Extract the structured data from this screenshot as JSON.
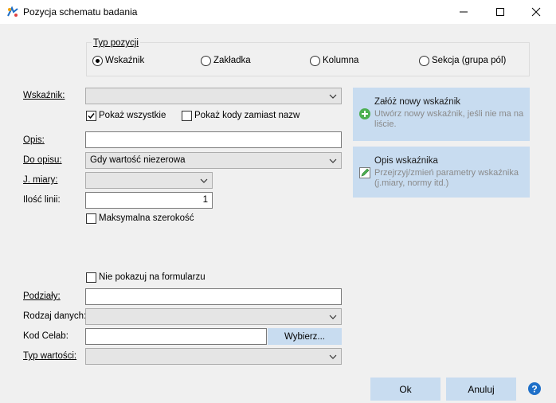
{
  "window": {
    "title": "Pozycja schematu badania",
    "icons": [
      "app-icon",
      "minimize-icon",
      "maximize-icon",
      "close-icon"
    ]
  },
  "type_group": {
    "title": "Typ pozycji",
    "options": [
      {
        "label": "Wskaźnik",
        "selected": true
      },
      {
        "label": "Zakładka",
        "selected": false
      },
      {
        "label": "Kolumna",
        "selected": false
      },
      {
        "label": "Sekcja (grupa pól)",
        "selected": false
      }
    ]
  },
  "form": {
    "wskaznik_label": "Wskaźnik:",
    "wskaznik_value": "",
    "show_all_label": "Pokaż wszystkie",
    "show_all_checked": true,
    "show_codes_label": "Pokaż kody zamiast nazw",
    "show_codes_checked": false,
    "opis_label": "Opis:",
    "opis_value": "",
    "do_opisu_label": "Do opisu:",
    "do_opisu_value": "Gdy wartość niezerowa",
    "j_miary_label": "J. miary:",
    "j_miary_value": "",
    "ilosc_linii_label": "Ilość linii:",
    "ilosc_linii_value": "1",
    "max_width_label": "Maksymalna szerokość",
    "max_width_checked": false,
    "hide_on_form_label": "Nie pokazuj na formularzu",
    "hide_on_form_checked": false,
    "podzialy_label": "Podziały:",
    "podzialy_value": "",
    "rodzaj_danych_label": "Rodzaj danych:",
    "rodzaj_danych_value": "",
    "kod_celab_label": "Kod Celab:",
    "kod_celab_value": "",
    "wybierz_label": "Wybierz...",
    "typ_wartosci_label": "Typ wartości:",
    "typ_wartosci_value": ""
  },
  "actions": {
    "new_indicator": {
      "title": "Załóż nowy wskaźnik",
      "description": "Utwórz nowy wskaźnik, jeśli nie ma na liście."
    },
    "indicator_desc": {
      "title": "Opis wskaźnika",
      "description": "Przejrzyj/zmień parametry wskaźnika (j.miary, normy itd.)"
    }
  },
  "footer": {
    "ok_label": "Ok",
    "cancel_label": "Anuluj"
  },
  "colors": {
    "accent": "#c8dcf0",
    "help": "#1e6fc8",
    "add_icon": "#4caf50"
  }
}
